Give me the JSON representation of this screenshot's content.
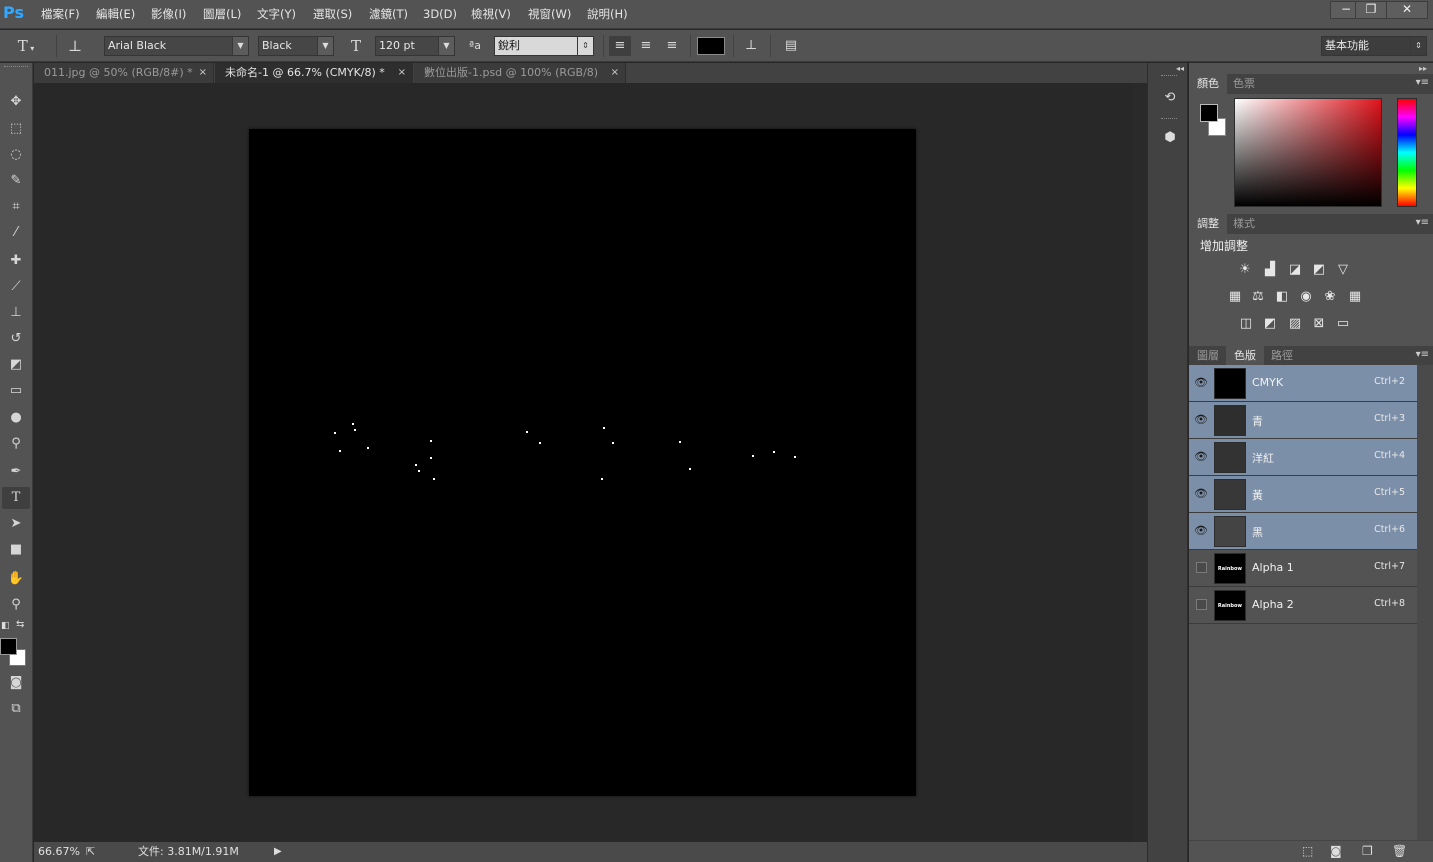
{
  "app": {
    "logo": "Ps"
  },
  "menu": [
    "檔案(F)",
    "編輯(E)",
    "影像(I)",
    "圖層(L)",
    "文字(Y)",
    "選取(S)",
    "濾鏡(T)",
    "3D(D)",
    "檢視(V)",
    "視窗(W)",
    "說明(H)"
  ],
  "window_controls": {
    "minimize": "−",
    "restore": "❐",
    "close": "✕"
  },
  "options": {
    "font_family": "Arial Black",
    "font_style": "Black",
    "font_size": "120 pt",
    "antialias_icon_label": "ªa",
    "antialias": "銳利",
    "text_color": "#000000",
    "workspace": "基本功能"
  },
  "tabs": [
    {
      "label": "011.jpg @ 50% (RGB/8#) *",
      "close": "×"
    },
    {
      "label": "未命名-1 @ 66.7% (CMYK/8) *",
      "close": "×"
    },
    {
      "label": "數位出版-1.psd @ 100% (RGB/8)",
      "close": "×"
    }
  ],
  "status": {
    "zoom": "66.67%",
    "doc_info": "文件: 3.81M/1.91M"
  },
  "color_panel": {
    "tabs": [
      "顏色",
      "色票"
    ],
    "fg": "#000000",
    "bg": "#ffffff"
  },
  "adjust_panel": {
    "tabs": [
      "調整",
      "樣式"
    ],
    "heading": "增加調整"
  },
  "channels_panel": {
    "tabs": [
      "圖層",
      "色版",
      "路徑"
    ],
    "channels": [
      {
        "name": "CMYK",
        "shortcut": "Ctrl+2",
        "visible": true,
        "selected": true,
        "thumb": "#000000"
      },
      {
        "name": "青",
        "shortcut": "Ctrl+3",
        "visible": true,
        "selected": true,
        "thumb": "#2e2e2e"
      },
      {
        "name": "洋紅",
        "shortcut": "Ctrl+4",
        "visible": true,
        "selected": true,
        "thumb": "#333333"
      },
      {
        "name": "黃",
        "shortcut": "Ctrl+5",
        "visible": true,
        "selected": true,
        "thumb": "#383838"
      },
      {
        "name": "黑",
        "shortcut": "Ctrl+6",
        "visible": true,
        "selected": true,
        "thumb": "#444444"
      },
      {
        "name": "Alpha 1",
        "shortcut": "Ctrl+7",
        "visible": false,
        "selected": false,
        "thumb": "#000000",
        "thumb_text": "Rainbow"
      },
      {
        "name": "Alpha 2",
        "shortcut": "Ctrl+8",
        "visible": false,
        "selected": false,
        "thumb": "#000000",
        "thumb_text": "Rainbow"
      }
    ]
  }
}
